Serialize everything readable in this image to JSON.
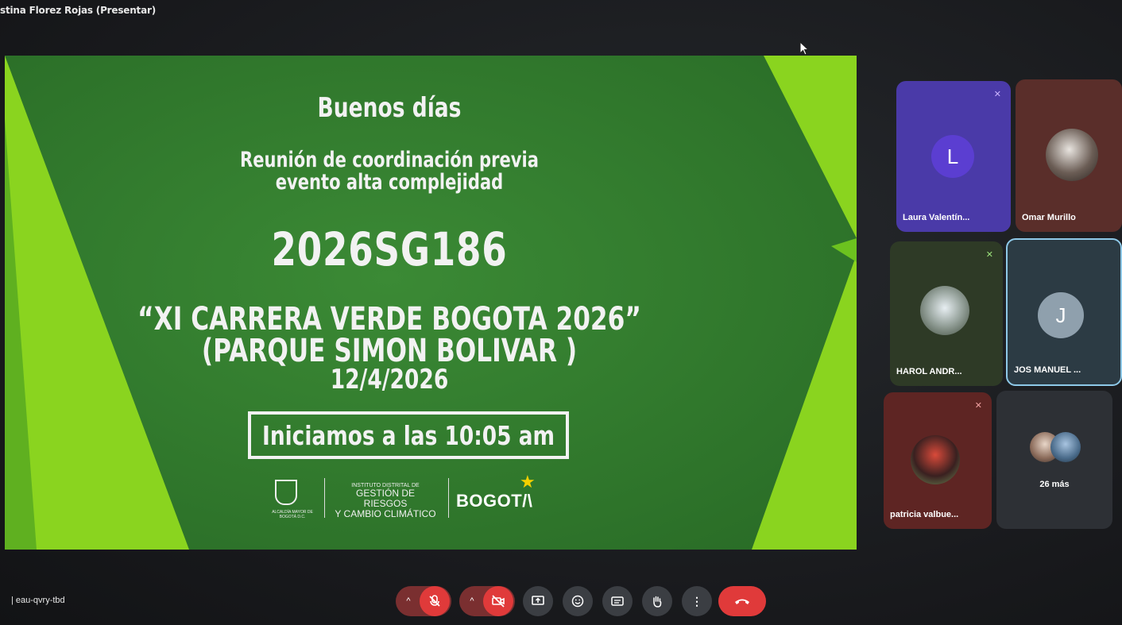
{
  "presenter": "stina Florez Rojas (Presentar)",
  "slide": {
    "greeting": "Buenos días",
    "subtitle_line1": "Reunión de coordinación previa",
    "subtitle_line2": "evento alta complejidad",
    "code": "2026SG186",
    "event_line1": "“XI CARRERA VERDE BOGOTA 2026”",
    "event_line2": "(PARQUE SIMON BOLIVAR )",
    "date": "12/4/2026",
    "start_notice": "Iniciamos a las 10:05 am",
    "logo_alcaldia": "ALCALDÍA MAYOR DE BOGOTÁ D.C.",
    "logo_inst_small": "INSTITUTO DISTRITAL DE",
    "logo_inst_line1": "GESTIÓN DE RIESGOS",
    "logo_inst_line2": "Y CAMBIO CLIMÁTICO",
    "logo_bogota": "BOGOT/\\"
  },
  "participants": [
    {
      "name": "Laura Valentín...",
      "initial": "L",
      "muted": true
    },
    {
      "name": "Omar Murillo",
      "muted": false
    },
    {
      "name": "HAROL ANDR...",
      "muted": true
    },
    {
      "name": "JOS MANUEL ...",
      "initial": "J",
      "muted": false
    },
    {
      "name": "patricia valbue...",
      "muted": true
    },
    {
      "more_label": "26 más"
    }
  ],
  "toolbar": {
    "meeting_code": "| eau-qvry-tbd",
    "mic_icon": "mic-off-icon",
    "camera_icon": "camera-off-icon",
    "present_icon": "present-icon",
    "emoji_icon": "emoji-icon",
    "captions_icon": "captions-icon",
    "hand_icon": "raise-hand-icon",
    "more_icon": "more-vert-icon",
    "leave_icon": "end-call-icon"
  },
  "colors": {
    "slide_green": "#2f7d2c",
    "accent_lime": "#7ed321",
    "end_call": "#e03a3a"
  }
}
